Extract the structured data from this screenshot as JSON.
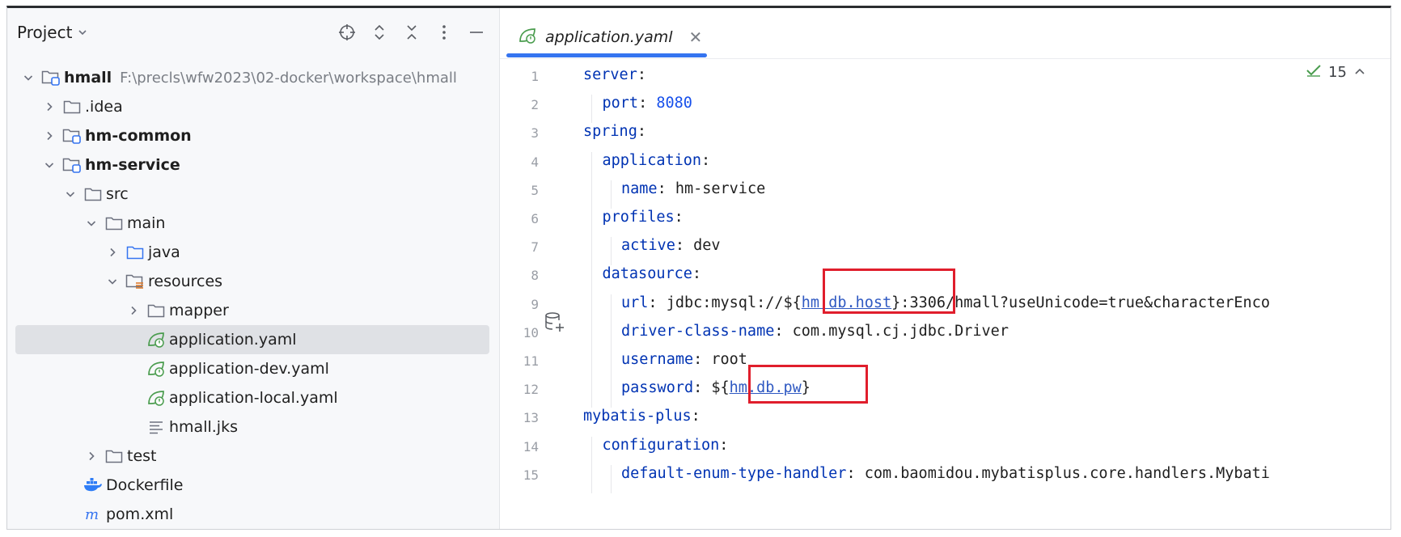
{
  "project_panel": {
    "title": "Project",
    "tree": [
      {
        "label": "hmall",
        "path": "F:\\precls\\wfw2023\\02-docker\\workspace\\hmall",
        "depth": 0,
        "expanded": true,
        "icon": "module-folder-icon",
        "bold": true
      },
      {
        "label": ".idea",
        "depth": 1,
        "expanded": false,
        "icon": "folder-icon"
      },
      {
        "label": "hm-common",
        "depth": 1,
        "expanded": false,
        "icon": "module-folder-icon",
        "bold": true
      },
      {
        "label": "hm-service",
        "depth": 1,
        "expanded": true,
        "icon": "module-folder-icon",
        "bold": true
      },
      {
        "label": "src",
        "depth": 2,
        "expanded": true,
        "icon": "folder-icon"
      },
      {
        "label": "main",
        "depth": 3,
        "expanded": true,
        "icon": "folder-icon"
      },
      {
        "label": "java",
        "depth": 4,
        "expanded": false,
        "icon": "source-folder-icon"
      },
      {
        "label": "resources",
        "depth": 4,
        "expanded": true,
        "icon": "resources-folder-icon"
      },
      {
        "label": "mapper",
        "depth": 5,
        "expanded": false,
        "icon": "folder-icon"
      },
      {
        "label": "application.yaml",
        "depth": 5,
        "leaf": true,
        "icon": "spring-yaml-icon",
        "selected": true
      },
      {
        "label": "application-dev.yaml",
        "depth": 5,
        "leaf": true,
        "icon": "spring-yaml-icon"
      },
      {
        "label": "application-local.yaml",
        "depth": 5,
        "leaf": true,
        "icon": "spring-yaml-icon"
      },
      {
        "label": "hmall.jks",
        "depth": 5,
        "leaf": true,
        "icon": "text-file-icon"
      },
      {
        "label": "test",
        "depth": 3,
        "expanded": false,
        "icon": "folder-icon"
      },
      {
        "label": "Dockerfile",
        "depth": 2,
        "leaf": true,
        "icon": "docker-icon"
      },
      {
        "label": "pom.xml",
        "depth": 2,
        "leaf": true,
        "icon": "maven-icon"
      }
    ]
  },
  "editor": {
    "tab_label": "application.yaml",
    "inspection_count": "15",
    "lines": [
      {
        "n": "1",
        "indent": 0,
        "key": "server",
        "sep": ":",
        "value": ""
      },
      {
        "n": "2",
        "indent": 1,
        "key": "port",
        "sep": ": ",
        "value": "8080",
        "num": true
      },
      {
        "n": "3",
        "indent": 0,
        "key": "spring",
        "sep": ":",
        "value": ""
      },
      {
        "n": "4",
        "indent": 1,
        "key": "application",
        "sep": ":",
        "value": ""
      },
      {
        "n": "5",
        "indent": 2,
        "key": "name",
        "sep": ": ",
        "value": "hm-service"
      },
      {
        "n": "6",
        "indent": 1,
        "key": "profiles",
        "sep": ":",
        "value": ""
      },
      {
        "n": "7",
        "indent": 2,
        "key": "active",
        "sep": ": ",
        "value": "dev"
      },
      {
        "n": "8",
        "indent": 1,
        "key": "datasource",
        "sep": ":",
        "value": ""
      },
      {
        "n": "9",
        "indent": 2,
        "key": "url",
        "sep": ": ",
        "value_pre": "jdbc:mysql://${",
        "value_link": "hm.db.host",
        "value_post": "}:3306/hmall?useUnicode=true&characterEnco"
      },
      {
        "n": "10",
        "indent": 2,
        "key": "driver-class-name",
        "sep": ": ",
        "value": "com.mysql.cj.jdbc.Driver"
      },
      {
        "n": "11",
        "indent": 2,
        "key": "username",
        "sep": ": ",
        "value": "root"
      },
      {
        "n": "12",
        "indent": 2,
        "key": "password",
        "sep": ": ",
        "value_pre": "${",
        "value_link": "hm.db.pw",
        "value_post": "}"
      },
      {
        "n": "13",
        "indent": 0,
        "key": "mybatis-plus",
        "sep": ":",
        "value": ""
      },
      {
        "n": "14",
        "indent": 1,
        "key": "configuration",
        "sep": ":",
        "value": ""
      },
      {
        "n": "15",
        "indent": 2,
        "key": "default-enum-type-handler",
        "sep": ": ",
        "value": "com.baomidou.mybatisplus.core.handlers.Mybati"
      }
    ]
  },
  "colors": {
    "accent": "#3574f0",
    "highlight_box": "#e01e2c",
    "yaml_key": "#0033b3"
  }
}
